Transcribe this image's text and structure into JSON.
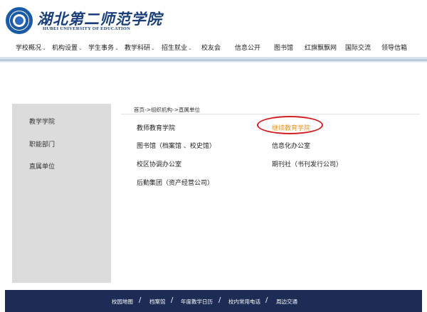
{
  "header": {
    "logo_cn": "湖北第二师范学院",
    "logo_en": "HUBEI UNIVERSITY OF EDUCATION"
  },
  "nav": {
    "items": [
      {
        "label": "学校概况",
        "dropdown": true
      },
      {
        "label": "机构设置",
        "dropdown": true
      },
      {
        "label": "学生事务",
        "dropdown": true
      },
      {
        "label": "教学科研",
        "dropdown": true
      },
      {
        "label": "招生就业",
        "dropdown": true
      },
      {
        "label": "校友会",
        "dropdown": false
      },
      {
        "label": "信息公开",
        "dropdown": false
      },
      {
        "label": "图书馆",
        "dropdown": false
      },
      {
        "label": "红旗飘飘网",
        "dropdown": false
      },
      {
        "label": "国际交流",
        "dropdown": false
      },
      {
        "label": "领导信箱",
        "dropdown": false
      }
    ]
  },
  "sidebar": {
    "items": [
      {
        "label": "教学学院"
      },
      {
        "label": "职能部门"
      },
      {
        "label": "直属单位"
      }
    ]
  },
  "breadcrumb": "首页->组织机构->直属单位",
  "links": [
    {
      "label": "教师教育学院",
      "highlight": false
    },
    {
      "label": "继续教育学院",
      "highlight": true
    },
    {
      "label": "图书馆（档案馆 、校史馆）",
      "highlight": false
    },
    {
      "label": "信息化办公室",
      "highlight": false
    },
    {
      "label": "校区协调办公室",
      "highlight": false
    },
    {
      "label": "期刊社（书刊发行公司）",
      "highlight": false
    },
    {
      "label": "后勤集团（资产经营公司）",
      "highlight": false
    }
  ],
  "footer": {
    "items": [
      {
        "label": "校园地图"
      },
      {
        "label": "档案馆"
      },
      {
        "label": "年度教学日历"
      },
      {
        "label": "校内常用电话"
      },
      {
        "label": "周边交通"
      }
    ]
  },
  "colors": {
    "highlight_text": "#e8951c",
    "annotation_circle": "#d21f1f",
    "footer_bg": "#1c2c55",
    "sidebar_bg": "#dcdcdc"
  }
}
